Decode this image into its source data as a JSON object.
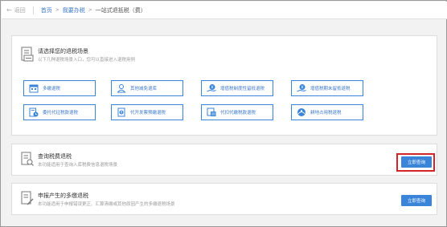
{
  "breadcrumb": {
    "back_label": "返回",
    "items": [
      "首页",
      "我要办税",
      "一站式退抵税（费）"
    ]
  },
  "scenario_panel": {
    "title": "请选择您的退税场景",
    "subtitle": "以下几种退税场景入口，您可以直接进入退税用例",
    "tiles": [
      {
        "label": "多缴退税",
        "icon": "calendar-icon"
      },
      {
        "label": "其他减免退库",
        "icon": "person-icon"
      },
      {
        "label": "增值税制度性留抵退税",
        "icon": "money-hand-icon"
      },
      {
        "label": "增值税期末留抵退税",
        "icon": "money-hand-icon"
      },
      {
        "label": "委托代征税款退税",
        "icon": "document-clock-icon"
      },
      {
        "label": "代开发票预缴退税",
        "icon": "invoice-icon"
      },
      {
        "label": "代扣代缴税款退税",
        "icon": "document-card-icon"
      },
      {
        "label": "耕地占用税退税",
        "icon": "land-icon"
      }
    ]
  },
  "query_panel": {
    "title": "查询税费退税",
    "subtitle": "本功能适用于查询入库税费信息退税场景",
    "button_label": "立即查询"
  },
  "overpay_panel": {
    "title": "申报产生的多缴退税",
    "subtitle": "本功能适用于申报错误更正、汇算清缴或其他原因产生的多缴退税场景",
    "button_label": "立即查询"
  },
  "colors": {
    "accent": "#3a84d9",
    "highlight": "#d2252c"
  }
}
